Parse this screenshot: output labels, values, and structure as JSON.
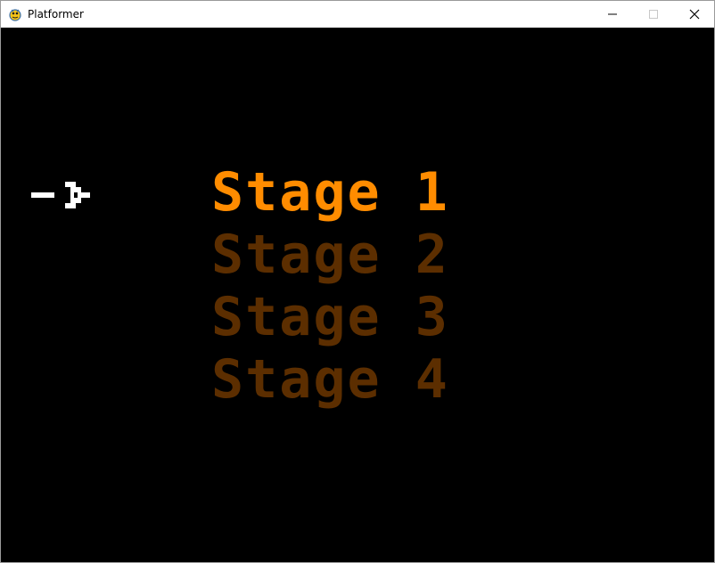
{
  "window": {
    "title": "Platformer",
    "app_icon": "pygame-snake-icon",
    "controls": {
      "minimize": "minimize-icon",
      "maximize": "maximize-icon",
      "close": "close-icon"
    }
  },
  "menu": {
    "selected_index": 0,
    "selector_icon": "arrow-right-icon",
    "selected_color": "#ff8c00",
    "unselected_color": "#5c2e00",
    "selector_color": "#ffffff",
    "items": [
      {
        "label": "Stage 1"
      },
      {
        "label": "Stage 2"
      },
      {
        "label": "Stage 3"
      },
      {
        "label": "Stage 4"
      }
    ]
  }
}
